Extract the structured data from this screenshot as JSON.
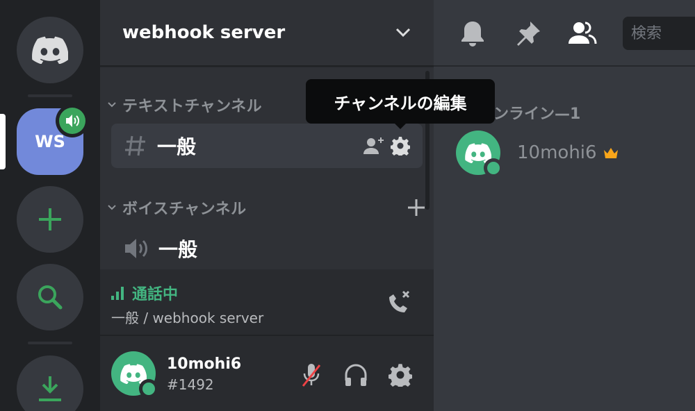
{
  "server": {
    "name": "webhook server",
    "abbrev": "WS"
  },
  "categories": {
    "text": "テキストチャンネル",
    "voice": "ボイスチャンネル"
  },
  "channels": {
    "text_active": "一般",
    "voice": "一般"
  },
  "tooltip": "チャンネルの編集",
  "voice_connection": {
    "status": "通話中",
    "location": "一般 / webhook server"
  },
  "user": {
    "name": "10mohi6",
    "tag": "#1492"
  },
  "search": {
    "placeholder": "検索"
  },
  "members": {
    "category": "オンライン—1",
    "list": [
      {
        "name": "10mohi6",
        "status": "online",
        "owner": true
      }
    ]
  },
  "colors": {
    "brand": "#7289da",
    "online": "#43b581",
    "speaking": "#3ba55c",
    "owner_crown": "#faa61a",
    "muted_slash": "#ed4245"
  }
}
